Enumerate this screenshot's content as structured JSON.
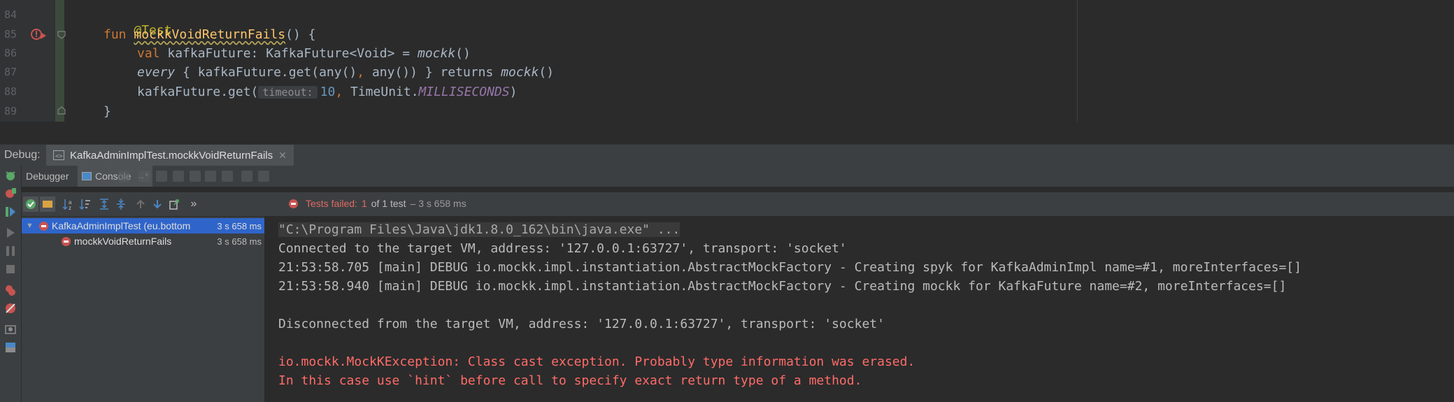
{
  "editor": {
    "line_numbers": [
      "84",
      "85",
      "86",
      "87",
      "88",
      "89"
    ],
    "lines": {
      "l84": {
        "annotation": "@Test"
      },
      "l85": {
        "kw": "fun",
        "fn_name": "mockkVoidReturnFails",
        "rest": "() {"
      },
      "l86": {
        "kw": "val",
        "decl": " kafkaFuture: KafkaFuture<Void> = ",
        "call": "mockk",
        "tail": "()"
      },
      "l87": {
        "every": "every",
        "mid": " { kafkaFuture.get(any()",
        "comma": ",",
        "mid2": " any()) } returns ",
        "call": "mockk",
        "tail": "()"
      },
      "l88": {
        "pre": "kafkaFuture.get(",
        "hint": "timeout:",
        "num": "10",
        "comma": ",",
        "mid": " TimeUnit.",
        "const": "MILLISECONDS",
        "tail": ")"
      },
      "l89": {
        "brace": "}"
      }
    }
  },
  "debug": {
    "label": "Debug:",
    "tab_title": "KafkaAdminImplTest.mockkVoidReturnFails",
    "subtabs": {
      "debugger": "Debugger",
      "console": "Console",
      "console_suffix": "→*"
    },
    "status": {
      "failed_label": "Tests failed:",
      "failed_count": "1",
      "of_text": "of 1 test",
      "duration": "– 3 s 658 ms"
    },
    "toolbar_more": "»"
  },
  "tree": {
    "root": {
      "name": "KafkaAdminImplTest (eu.bottom",
      "duration": "3 s 658 ms"
    },
    "child": {
      "name": "mockkVoidReturnFails",
      "duration": "3 s 658 ms"
    }
  },
  "console": {
    "lines": [
      "\"C:\\Program Files\\Java\\jdk1.8.0_162\\bin\\java.exe\" ...",
      "Connected to the target VM, address: '127.0.0.1:63727', transport: 'socket'",
      "21:53:58.705 [main] DEBUG io.mockk.impl.instantiation.AbstractMockFactory - Creating spyk for KafkaAdminImpl name=#1, moreInterfaces=[]",
      "21:53:58.940 [main] DEBUG io.mockk.impl.instantiation.AbstractMockFactory - Creating mockk for KafkaFuture name=#2, moreInterfaces=[]",
      "",
      "Disconnected from the target VM, address: '127.0.0.1:63727', transport: 'socket'",
      "",
      "io.mockk.MockKException: Class cast exception. Probably type information was erased.",
      "In this case use `hint` before call to specify exact return type of a method."
    ]
  },
  "colors": {
    "keyword": "#cc7832",
    "function": "#ffc66d",
    "number": "#6897bb",
    "error": "#ff6b68",
    "selection": "#2f65ca"
  }
}
